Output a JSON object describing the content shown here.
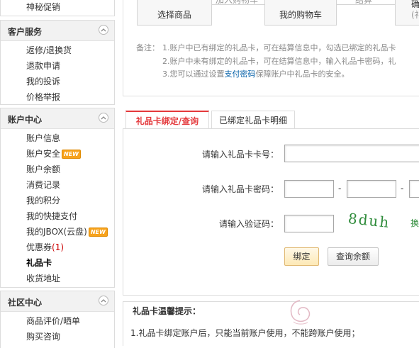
{
  "sidebar": {
    "top_item": "神秘促销",
    "sections": [
      {
        "title": "客户服务",
        "items": [
          "返修/退换货",
          "退款申请",
          "我的投诉",
          "价格举报"
        ]
      },
      {
        "title": "账户中心",
        "items": [
          {
            "label": "账户信息"
          },
          {
            "label": "账户安全",
            "badge": "NEW"
          },
          {
            "label": "账户余额"
          },
          {
            "label": "消费记录"
          },
          {
            "label": "我的积分"
          },
          {
            "label": "我的快捷支付"
          },
          {
            "label": "我的JBOX(云盘)",
            "badge": "NEW"
          },
          {
            "label": "优惠券",
            "count": "(1)"
          },
          {
            "label": "礼品卡",
            "active": true
          },
          {
            "label": "收货地址"
          }
        ]
      },
      {
        "title": "社区中心",
        "items": [
          "商品评价/晒单",
          "购买咨询"
        ]
      }
    ]
  },
  "steps": {
    "select_goods": "选择商品",
    "add_to_cart": "加入购物车",
    "my_cart": "我的购物车",
    "checkout": "结算",
    "fourth_top": "确认",
    "fourth_bottom": "(礼"
  },
  "notes": {
    "prefix": "备注：",
    "line1": "1.账户中已有绑定的礼品卡，可在结算信息中，勾选已绑定的礼品卡",
    "line2": "2.账户中未有绑定的礼品卡，可在结算信息中，输入礼品卡密码，礼",
    "line3_before": "3.您可以通过设置",
    "line3_link": "支付密码",
    "line3_after": "保障账户中礼品卡的安全。"
  },
  "tabs": {
    "bind_query": "礼品卡绑定/查询",
    "bound_details": "已绑定礼品卡明细"
  },
  "form": {
    "card_number_label": "请输入礼品卡卡号：",
    "card_password_label": "请输入礼品卡密码：",
    "captcha_label": "请输入验证码：",
    "captcha_text": "8duh",
    "captcha_refresh": "换",
    "card_number_value": "",
    "password_parts": [
      "",
      "",
      ""
    ],
    "captcha_value": "",
    "bind_button": "绑定",
    "check_balance_button": "查询余额",
    "dash": "-"
  },
  "tips": {
    "title": "礼品卡温馨提示：",
    "line1": "1.礼品卡绑定账户后，只能当前账户使用，不能跨账户使用；"
  },
  "colors": {
    "accent_red": "#e4393c",
    "link_blue": "#005ea7",
    "badge_orange": "#f7a21b",
    "captcha_green": "#2e8b3a"
  }
}
